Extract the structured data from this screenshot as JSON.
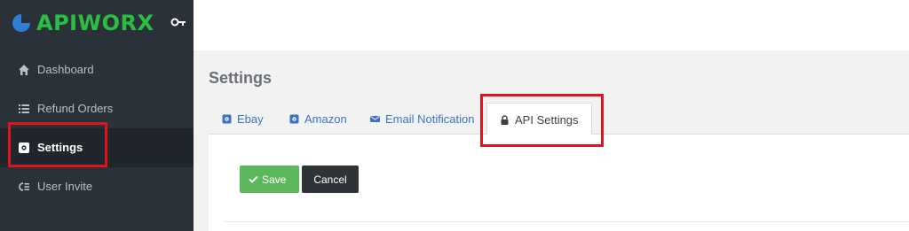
{
  "brand": {
    "name": "APIWORX",
    "color": "#29c041"
  },
  "sidebar": {
    "items": [
      {
        "label": "Dashboard",
        "icon": "home-icon"
      },
      {
        "label": "Refund Orders",
        "icon": "list-icon"
      },
      {
        "label": "Settings",
        "icon": "gear-icon",
        "active": true
      },
      {
        "label": "User Invite",
        "icon": "user-invite-icon"
      }
    ]
  },
  "main": {
    "title": "Settings",
    "tabs": [
      {
        "label": "Ebay",
        "icon": "gear-icon"
      },
      {
        "label": "Amazon",
        "icon": "gear-icon"
      },
      {
        "label": "Email Notification",
        "icon": "envelope-icon"
      },
      {
        "label": "API Settings",
        "icon": "lock-icon",
        "active": true
      }
    ],
    "buttons": {
      "save": "Save",
      "cancel": "Cancel"
    }
  },
  "colors": {
    "sidebar_bg": "#2a3138",
    "highlight": "#e0141b",
    "save_green": "#5cb85c",
    "link_blue": "#3d73c4"
  }
}
